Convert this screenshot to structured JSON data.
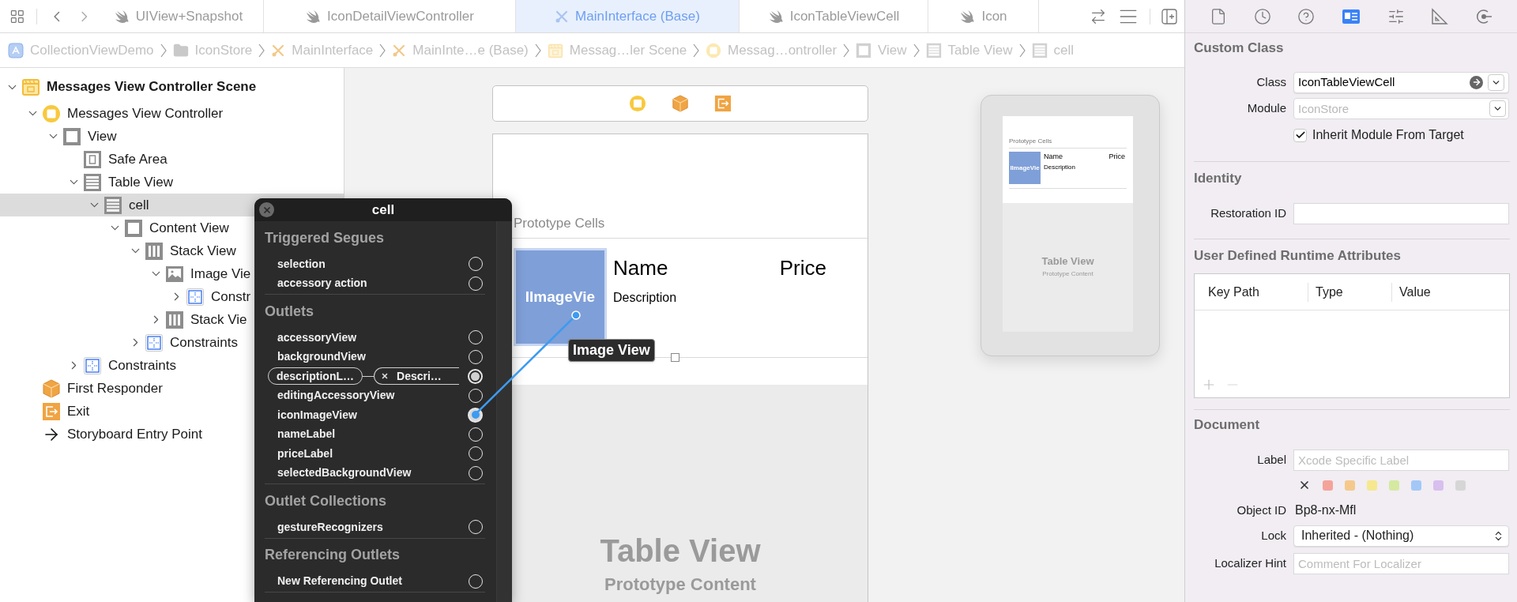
{
  "editor_tabs": [
    {
      "label": "UIView+Snapshot",
      "kind": "swift",
      "selected": false
    },
    {
      "label": "IconDetailViewController",
      "kind": "swift",
      "selected": false
    },
    {
      "label": "MainInterface (Base)",
      "kind": "storyboard",
      "selected": true
    },
    {
      "label": "IconTableViewCell",
      "kind": "swift",
      "selected": false
    },
    {
      "label": "Icon",
      "kind": "swift",
      "selected": false
    }
  ],
  "breadcrumb": [
    {
      "label": "CollectionViewDemo",
      "kind": "app"
    },
    {
      "label": "IconStore",
      "kind": "folder"
    },
    {
      "label": "MainInterface",
      "kind": "storyboard"
    },
    {
      "label": "MainInte…e (Base)",
      "kind": "storyboard"
    },
    {
      "label": "Messag…ler Scene",
      "kind": "scene"
    },
    {
      "label": "Messag…ontroller",
      "kind": "controller"
    },
    {
      "label": "View",
      "kind": "view"
    },
    {
      "label": "Table View",
      "kind": "table"
    },
    {
      "label": "cell",
      "kind": "table"
    }
  ],
  "outline": [
    {
      "label": "Messages View Controller Scene",
      "kind": "scene",
      "expanded": true,
      "selected": false,
      "children": [
        {
          "label": "Messages View Controller",
          "kind": "controller",
          "expanded": true,
          "selected": false,
          "children": [
            {
              "label": "View",
              "kind": "view",
              "expanded": true,
              "selected": false,
              "children": [
                {
                  "label": "Safe Area",
                  "kind": "safe_area",
                  "selected": false
                },
                {
                  "label": "Table View",
                  "kind": "table",
                  "expanded": true,
                  "selected": false,
                  "children": [
                    {
                      "label": "cell",
                      "kind": "cell",
                      "expanded": true,
                      "selected": true,
                      "children": [
                        {
                          "label": "Content View",
                          "kind": "view",
                          "expanded": true,
                          "selected": false,
                          "children": [
                            {
                              "label": "Stack View",
                              "kind": "stack",
                              "expanded": true,
                              "selected": false,
                              "children": [
                                {
                                  "label": "Image Vie",
                                  "kind": "image",
                                  "expanded": true,
                                  "selected": false,
                                  "children": [
                                    {
                                      "label": "Constr",
                                      "kind": "constraints",
                                      "expanded": false,
                                      "selected": false
                                    }
                                  ]
                                },
                                {
                                  "label": "Stack Vie",
                                  "kind": "stack",
                                  "expanded": false,
                                  "selected": false
                                }
                              ]
                            },
                            {
                              "label": "Constraints",
                              "kind": "constraints",
                              "expanded": false,
                              "selected": false
                            }
                          ]
                        }
                      ]
                    }
                  ]
                },
                {
                  "label": "Constraints",
                  "kind": "constraints",
                  "expanded": false,
                  "selected": false
                }
              ]
            }
          ]
        },
        {
          "label": "First Responder",
          "kind": "responder",
          "selected": false
        },
        {
          "label": "Exit",
          "kind": "exit",
          "selected": false
        },
        {
          "label": "Storyboard Entry Point",
          "kind": "entry",
          "selected": false
        }
      ]
    }
  ],
  "connections_popup": {
    "title": "cell",
    "sections": [
      {
        "title": "Triggered Segues",
        "items": [
          {
            "label": "selection",
            "kind": "empty"
          },
          {
            "label": "accessory action",
            "kind": "empty"
          }
        ]
      },
      {
        "title": "Outlets",
        "items": [
          {
            "label": "accessoryView",
            "kind": "empty"
          },
          {
            "label": "backgroundView",
            "kind": "empty"
          },
          {
            "label": "descriptionL…",
            "kind": "connected",
            "target": "Descri…"
          },
          {
            "label": "editingAccessoryView",
            "kind": "empty"
          },
          {
            "label": "iconImageView",
            "kind": "dragging"
          },
          {
            "label": "nameLabel",
            "kind": "empty"
          },
          {
            "label": "priceLabel",
            "kind": "empty"
          },
          {
            "label": "selectedBackgroundView",
            "kind": "empty"
          }
        ]
      },
      {
        "title": "Outlet Collections",
        "items": [
          {
            "label": "gestureRecognizers",
            "kind": "empty"
          }
        ]
      },
      {
        "title": "Referencing Outlets",
        "items": [
          {
            "label": "New Referencing Outlet",
            "kind": "empty"
          }
        ]
      }
    ]
  },
  "canvas": {
    "dock": [
      {
        "kind": "controller"
      },
      {
        "kind": "responder"
      },
      {
        "kind": "exit"
      }
    ],
    "scene": {
      "section_header": "Prototype Cells",
      "image_placeholder": "IImageVie",
      "name": "Name",
      "price": "Price",
      "description": "Description",
      "background_title": "Table View",
      "background_subtitle": "Prototype Content"
    },
    "drag_tooltip": "Image View",
    "preview": {
      "section_header": "Prototype Cells",
      "image_placeholder": "IImageVie",
      "name": "Name",
      "price": "Price",
      "description": "Description",
      "background_title": "Table View",
      "background_subtitle": "Prototype Content"
    }
  },
  "inspector": {
    "tabs": [
      {
        "kind": "file",
        "selected": false
      },
      {
        "kind": "history",
        "selected": false
      },
      {
        "kind": "help",
        "selected": false
      },
      {
        "kind": "identity",
        "selected": true
      },
      {
        "kind": "attributes",
        "selected": false
      },
      {
        "kind": "size",
        "selected": false
      },
      {
        "kind": "connections",
        "selected": false
      }
    ],
    "custom_class": {
      "title": "Custom Class",
      "class_label": "Class",
      "class_value": "IconTableViewCell",
      "module_label": "Module",
      "module_placeholder": "IconStore",
      "inherit_label": "Inherit Module From Target",
      "inherit_checked": true
    },
    "identity": {
      "title": "Identity",
      "restoration_label": "Restoration ID"
    },
    "runtime_attributes": {
      "title": "User Defined Runtime Attributes",
      "columns": [
        "Key Path",
        "Type",
        "Value"
      ]
    },
    "document": {
      "title": "Document",
      "label_label": "Label",
      "label_placeholder": "Xcode Specific Label",
      "label_colors": [
        {
          "color": "#f4a39b"
        },
        {
          "color": "#f5c98c"
        },
        {
          "color": "#f6e88f"
        },
        {
          "color": "#d5e9a1"
        },
        {
          "color": "#a3c8f7"
        },
        {
          "color": "#d8bfee"
        },
        {
          "color": "#d6d6d6"
        }
      ],
      "object_id_label": "Object ID",
      "object_id": "Bp8-nx-Mfl",
      "lock_label": "Lock",
      "lock_value": "Inherited - (Nothing)",
      "localizer_label": "Localizer Hint",
      "localizer_placeholder": "Comment For Localizer"
    }
  }
}
